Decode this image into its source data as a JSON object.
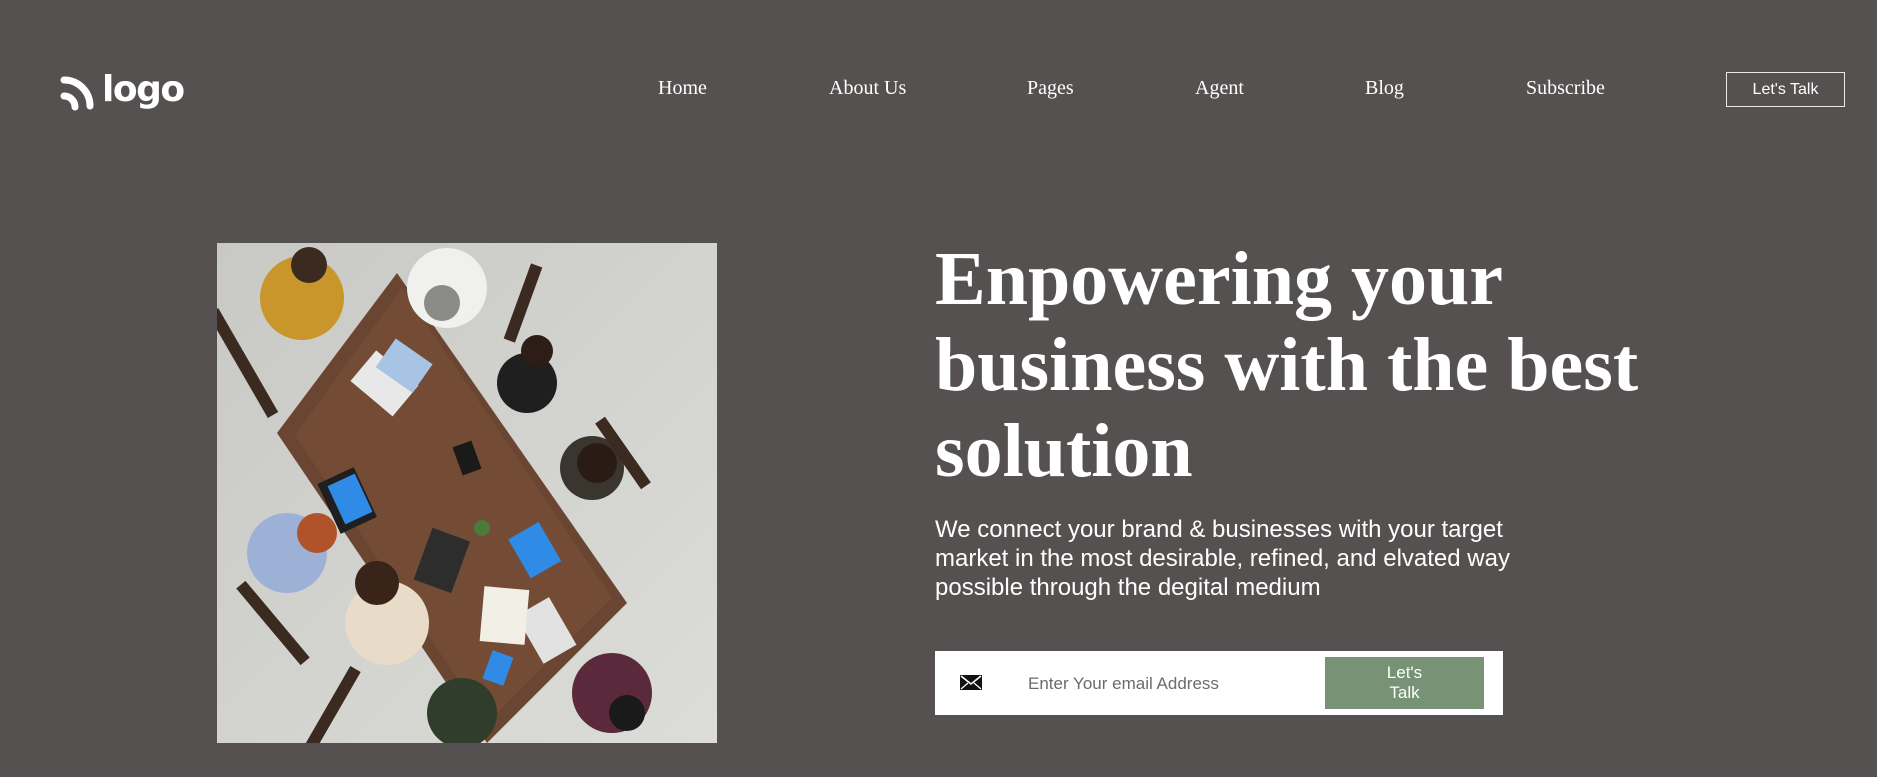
{
  "theme": {
    "background": "#555150",
    "accent": "#779274"
  },
  "header": {
    "logo_text": "logo",
    "logo_icon": "wave-arcs-icon",
    "nav": [
      {
        "label": "Home"
      },
      {
        "label": "About Us"
      },
      {
        "label": "Pages"
      },
      {
        "label": "Agent"
      },
      {
        "label": "Blog"
      },
      {
        "label": "Subscribe"
      }
    ],
    "cta_label": "Let's Talk"
  },
  "hero": {
    "image": "team-meeting-photo",
    "headline": "Enpowering your business with the best solution",
    "subtext": "We connect your brand & businesses with your target market in the most desirable, refined, and elvated way possible through the degital medium",
    "form": {
      "icon": "envelope-icon",
      "email_placeholder": "Enter Your email Address",
      "email_value": "",
      "submit_label": "Let's Talk"
    }
  }
}
